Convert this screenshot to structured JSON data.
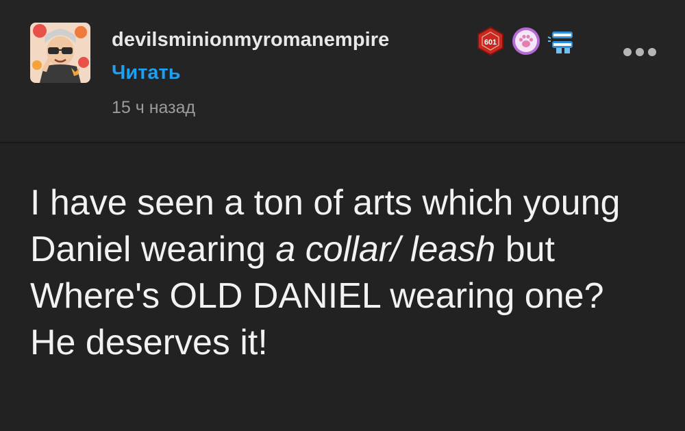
{
  "post": {
    "author": {
      "username": "devilsminionmyromanempire",
      "avatar_icon": "cartoon-avatar-with-sunglasses",
      "badges": [
        {
          "icon": "red-d20-badge",
          "text": "601",
          "color": "#c8281e"
        },
        {
          "icon": "paw-print-badge",
          "color": "#b56ad6"
        },
        {
          "icon": "blue-teeth-chatter-badge",
          "color": "#2f8fdc"
        }
      ]
    },
    "follow_label": "Читать",
    "timestamp": "15 ч назад",
    "more_icon": "ellipsis-icon",
    "body": {
      "segment1": "I have seen a ton of arts which young Daniel wearing ",
      "segment2_italic": "a collar/ leash",
      "segment3": " but Where's OLD DANIEL wearing one? He deserves it!"
    }
  },
  "colors": {
    "background": "#222222",
    "header_background": "#242424",
    "username": "#e8e8e8",
    "follow": "#1e9ff0",
    "timestamp": "#9c9c9c",
    "text": "#f2f2f2"
  }
}
